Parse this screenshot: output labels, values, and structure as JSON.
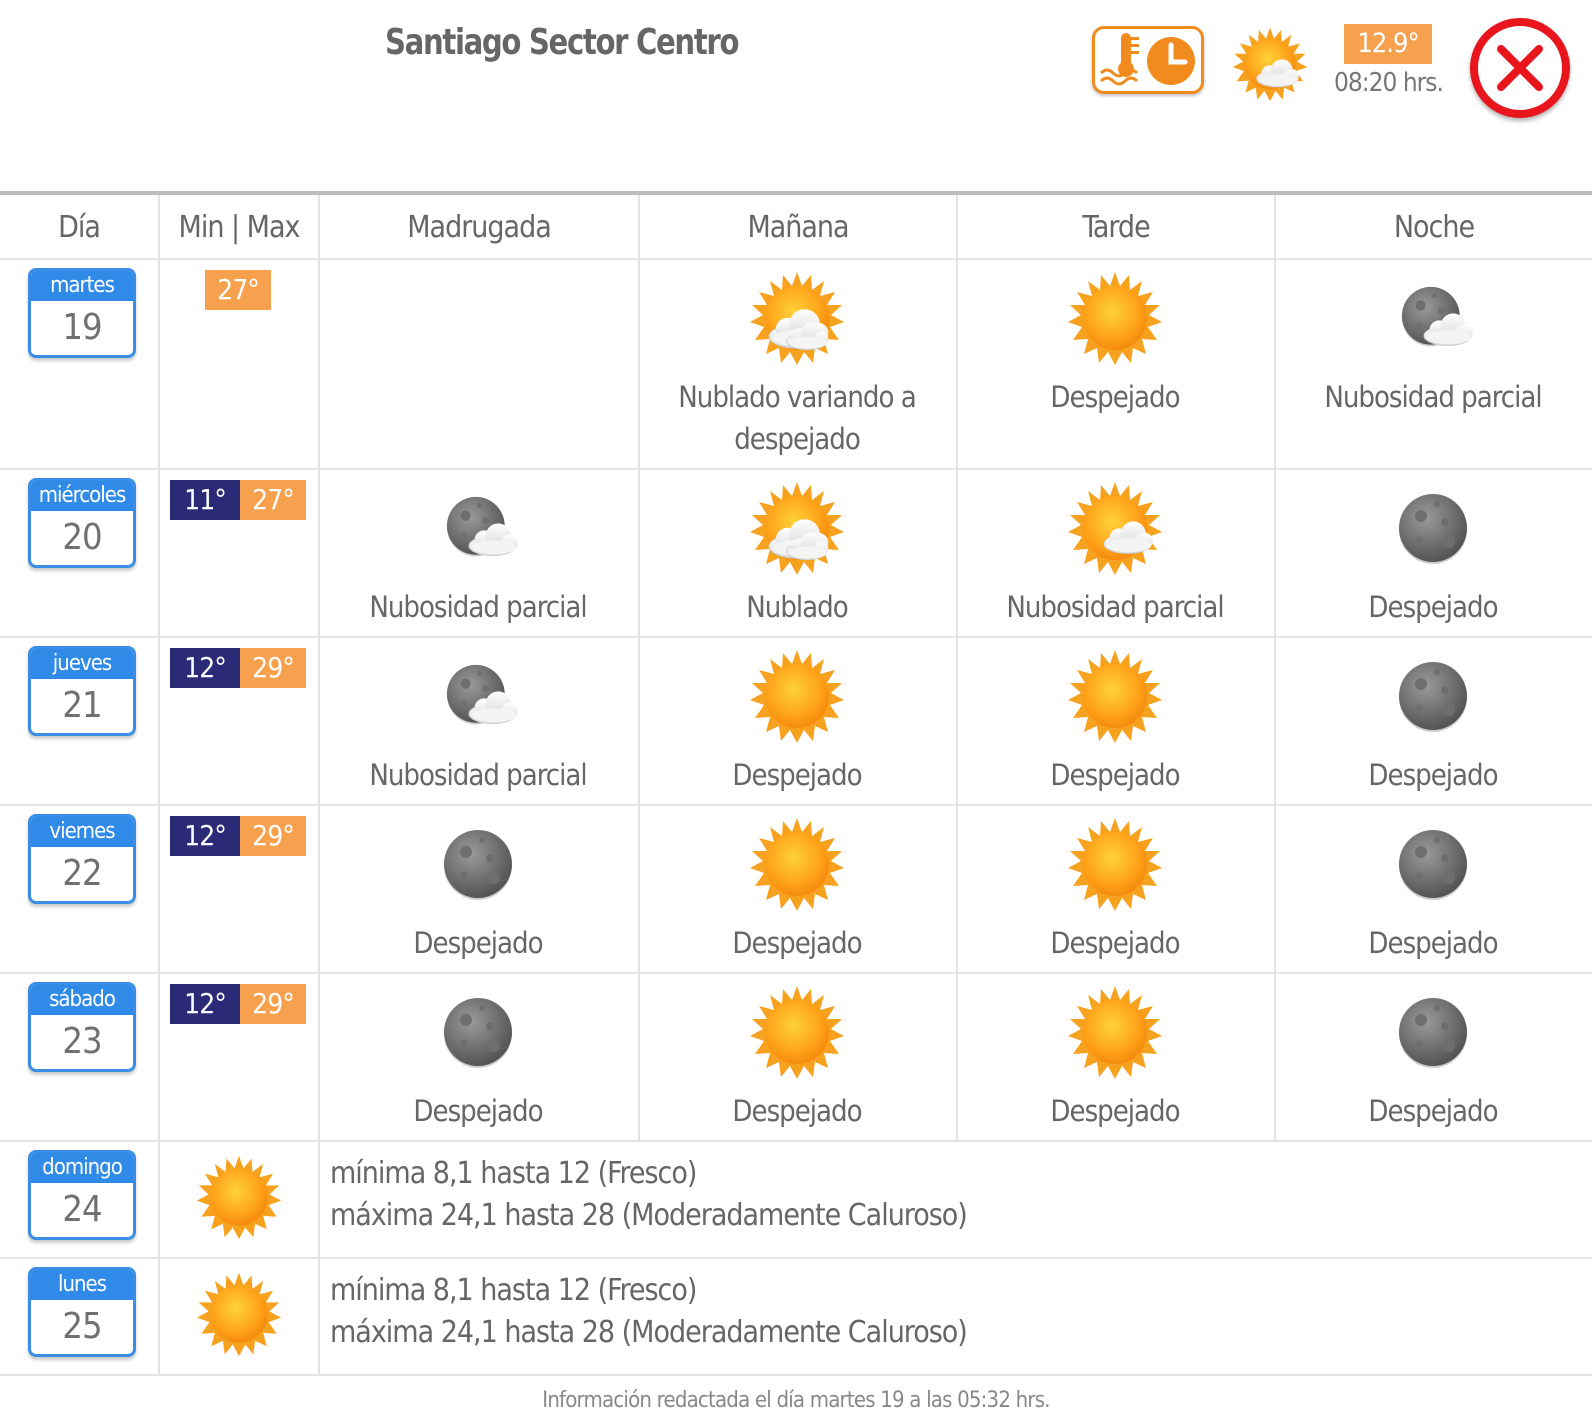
{
  "header": {
    "location": "Santiago Sector Centro",
    "current_temp": "12.9°",
    "current_time": "08:20 hrs.",
    "current_icon": "partly-cloudy-day-icon",
    "history_icon": "thermometer-clock-icon",
    "close_icon": "close-icon"
  },
  "columns": {
    "day": "Día",
    "minmax": "Min | Max",
    "madrugada": "Madrugada",
    "manana": "Mañana",
    "tarde": "Tarde",
    "noche": "Noche"
  },
  "days": [
    {
      "name": "martes",
      "num": "19",
      "min": "",
      "max": "27°",
      "periods": [
        {
          "icon": "",
          "label": ""
        },
        {
          "icon": "cloudy-sun-icon",
          "label": "Nublado variando a despejado"
        },
        {
          "icon": "sun-icon",
          "label": "Despejado"
        },
        {
          "icon": "moon-cloud-icon",
          "label": "Nubosidad parcial"
        }
      ]
    },
    {
      "name": "miércoles",
      "num": "20",
      "min": "11°",
      "max": "27°",
      "periods": [
        {
          "icon": "moon-cloud-icon",
          "label": "Nubosidad parcial"
        },
        {
          "icon": "cloudy-sun-icon",
          "label": "Nublado"
        },
        {
          "icon": "sun-cloud-icon",
          "label": "Nubosidad parcial"
        },
        {
          "icon": "moon-icon",
          "label": "Despejado"
        }
      ]
    },
    {
      "name": "jueves",
      "num": "21",
      "min": "12°",
      "max": "29°",
      "periods": [
        {
          "icon": "moon-cloud-icon",
          "label": "Nubosidad parcial"
        },
        {
          "icon": "sun-icon",
          "label": "Despejado"
        },
        {
          "icon": "sun-icon",
          "label": "Despejado"
        },
        {
          "icon": "moon-icon",
          "label": "Despejado"
        }
      ]
    },
    {
      "name": "viernes",
      "num": "22",
      "min": "12°",
      "max": "29°",
      "periods": [
        {
          "icon": "moon-icon",
          "label": "Despejado"
        },
        {
          "icon": "sun-icon",
          "label": "Despejado"
        },
        {
          "icon": "sun-icon",
          "label": "Despejado"
        },
        {
          "icon": "moon-icon",
          "label": "Despejado"
        }
      ]
    },
    {
      "name": "sábado",
      "num": "23",
      "min": "12°",
      "max": "29°",
      "periods": [
        {
          "icon": "moon-icon",
          "label": "Despejado"
        },
        {
          "icon": "sun-icon",
          "label": "Despejado"
        },
        {
          "icon": "sun-icon",
          "label": "Despejado"
        },
        {
          "icon": "moon-icon",
          "label": "Despejado"
        }
      ]
    }
  ],
  "extended": [
    {
      "name": "domingo",
      "num": "24",
      "icon": "sun-icon",
      "line1": "mínima 8,1 hasta 12 (Fresco)",
      "line2": "máxima 24,1 hasta 28 (Moderadamente Caluroso)"
    },
    {
      "name": "lunes",
      "num": "25",
      "icon": "sun-icon",
      "line1": "mínima 8,1 hasta 12 (Fresco)",
      "line2": "máxima 24,1 hasta 28 (Moderadamente Caluroso)"
    }
  ],
  "footer": "Información redactada el día martes 19 a las 05:32 hrs.",
  "colors": {
    "accent_orange": "#f7a14e",
    "min_navy": "#2b2a76",
    "calendar_blue": "#2f8ae8",
    "close_red": "#e8161c"
  }
}
